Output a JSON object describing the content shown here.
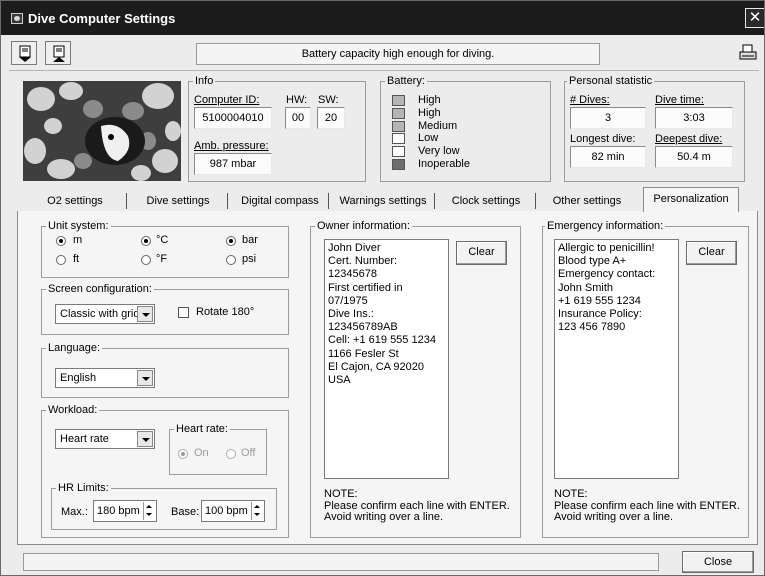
{
  "window": {
    "title": "Dive Computer Settings"
  },
  "toolbar": {
    "status": "Battery capacity high enough for diving."
  },
  "info": {
    "legend": "Info",
    "computer_id_label": "Computer ID:",
    "computer_id": "5100004010",
    "hw_label": "HW:",
    "hw": "00",
    "sw_label": "SW:",
    "sw": "20",
    "amb_label": "Amb. pressure:",
    "amb": "987 mbar"
  },
  "battery": {
    "legend": "Battery:",
    "levels": [
      {
        "label": "High",
        "color": "#b4b4b4"
      },
      {
        "label": "High",
        "color": "#b4b4b4"
      },
      {
        "label": "Medium",
        "color": "#b4b4b4"
      },
      {
        "label": "Low",
        "color": "#ffffff"
      },
      {
        "label": "Very low",
        "color": "#ffffff"
      },
      {
        "label": "Inoperable",
        "color": "#6e6e6e"
      }
    ]
  },
  "personal": {
    "legend": "Personal statistic",
    "dives_label": "# Dives:",
    "dives": "3",
    "divetime_label": "Dive time:",
    "divetime": "3:03",
    "longest_label": "Longest dive:",
    "longest": "82 min",
    "deepest_label": "Deepest dive:",
    "deepest": "50.4 m"
  },
  "tabs": [
    {
      "label": "O2 settings",
      "active": false
    },
    {
      "label": "Dive settings",
      "active": false
    },
    {
      "label": "Digital compass",
      "active": false
    },
    {
      "label": "Warnings settings",
      "active": false
    },
    {
      "label": "Clock settings",
      "active": false
    },
    {
      "label": "Other settings",
      "active": false
    },
    {
      "label": "Personalization",
      "active": true
    }
  ],
  "units": {
    "legend": "Unit system:",
    "m": "m",
    "ft": "ft",
    "c": "°C",
    "f": "°F",
    "bar": "bar",
    "psi": "psi",
    "selected": [
      "m",
      "c",
      "bar"
    ]
  },
  "screen": {
    "legend": "Screen configuration:",
    "selected": "Classic with grid",
    "rotate_label": "Rotate 180°",
    "rotate_checked": false
  },
  "language": {
    "legend": "Language:",
    "selected": "English"
  },
  "workload": {
    "legend": "Workload:",
    "selected": "Heart rate",
    "hr_legend": "Heart rate:",
    "on": "On",
    "off": "Off",
    "hr_selected": "On",
    "limits_legend": "HR Limits:",
    "max_label": "Max.:",
    "max": "180 bpm",
    "base_label": "Base:",
    "base": "100 bpm"
  },
  "owner": {
    "legend": "Owner information:",
    "lines": [
      "John Diver",
      "Cert. Number: 12345678",
      "First certified in 07/1975",
      "Dive Ins.: 123456789AB",
      "Cell: +1 619 555 1234",
      "1166 Fesler St",
      "El Cajon, CA 92020",
      "USA"
    ],
    "clear": "Clear",
    "note1": "NOTE:",
    "note2": "Please confirm each line with ENTER.",
    "note3": "Avoid writing over a line."
  },
  "emergency": {
    "legend": "Emergency information:",
    "lines": [
      "Allergic to penicillin!",
      "Blood type A+",
      "Emergency contact:",
      "John Smith",
      "+1 619 555 1234",
      "Insurance Policy:",
      "123 456 7890"
    ],
    "clear": "Clear",
    "note1": "NOTE:",
    "note2": "Please confirm each line with ENTER.",
    "note3": "Avoid writing over a line."
  },
  "footer": {
    "close": "Close"
  },
  "colors": {
    "titlebar": "#1c1c1c",
    "window": "#ececec",
    "panel": "#f5f5f5"
  }
}
